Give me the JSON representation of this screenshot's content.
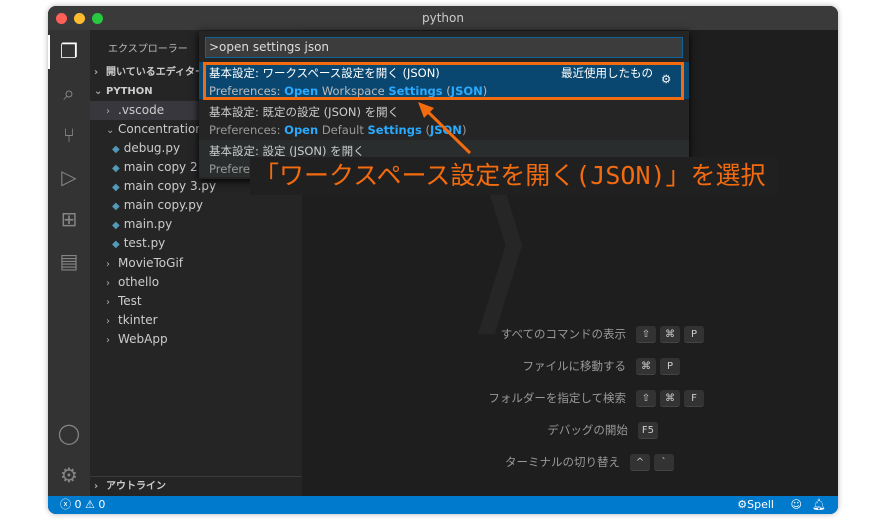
{
  "window": {
    "title": "python"
  },
  "activity": [
    "files-icon",
    "search-icon",
    "source-control-icon",
    "run-debug-icon",
    "extensions-icon",
    "remote-explorer-icon",
    "account-icon",
    "gear-icon"
  ],
  "sidebar": {
    "title": "エクスプローラー",
    "open_editors": "開いているエディター",
    "root": "PYTHON",
    "items": [
      ".vscode",
      "Concentration",
      "debug.py",
      "main copy 2.py",
      "main copy 3.py",
      "main copy.py",
      "main.py",
      "test.py",
      "MovieToGif",
      "othello",
      "Test",
      "tkinter",
      "WebApp"
    ],
    "outline": "アウトライン"
  },
  "palette": {
    "input": ">open settings json",
    "items": [
      {
        "title": "基本設定: ワークスペース設定を開く (JSON)",
        "tag": "最近使用したもの",
        "sub": [
          "Preferences: ",
          "Open",
          " Workspace ",
          "Settings",
          " (",
          "JSON",
          ")"
        ]
      },
      {
        "title": "基本設定: 既定の設定 (JSON) を開く",
        "sub": [
          "Preferences: ",
          "Open",
          " Default ",
          "Settings",
          " (",
          "JSON",
          ")"
        ]
      },
      {
        "title": "基本設定: 設定 (JSON) を開く",
        "sub": [
          "Preferer"
        ]
      }
    ]
  },
  "annotation": "「ワークスペース設定を開く(JSON)」を選択",
  "shortcuts": [
    {
      "label": "すべてのコマンドの表示",
      "keys": [
        "⇧",
        "⌘",
        "P"
      ]
    },
    {
      "label": "ファイルに移動する",
      "keys": [
        "⌘",
        "P"
      ]
    },
    {
      "label": "フォルダーを指定して検索",
      "keys": [
        "⇧",
        "⌘",
        "F"
      ]
    },
    {
      "label": "デバッグの開始",
      "keys": [
        "F5"
      ]
    },
    {
      "label": "ターミナルの切り替え",
      "keys": [
        "^",
        "`"
      ]
    }
  ],
  "status": {
    "errors": "0",
    "warnings": "0",
    "spell": "Spell"
  },
  "colors": {
    "accent": "#007acc",
    "highlight": "#f26b0f",
    "selection": "#094771"
  }
}
